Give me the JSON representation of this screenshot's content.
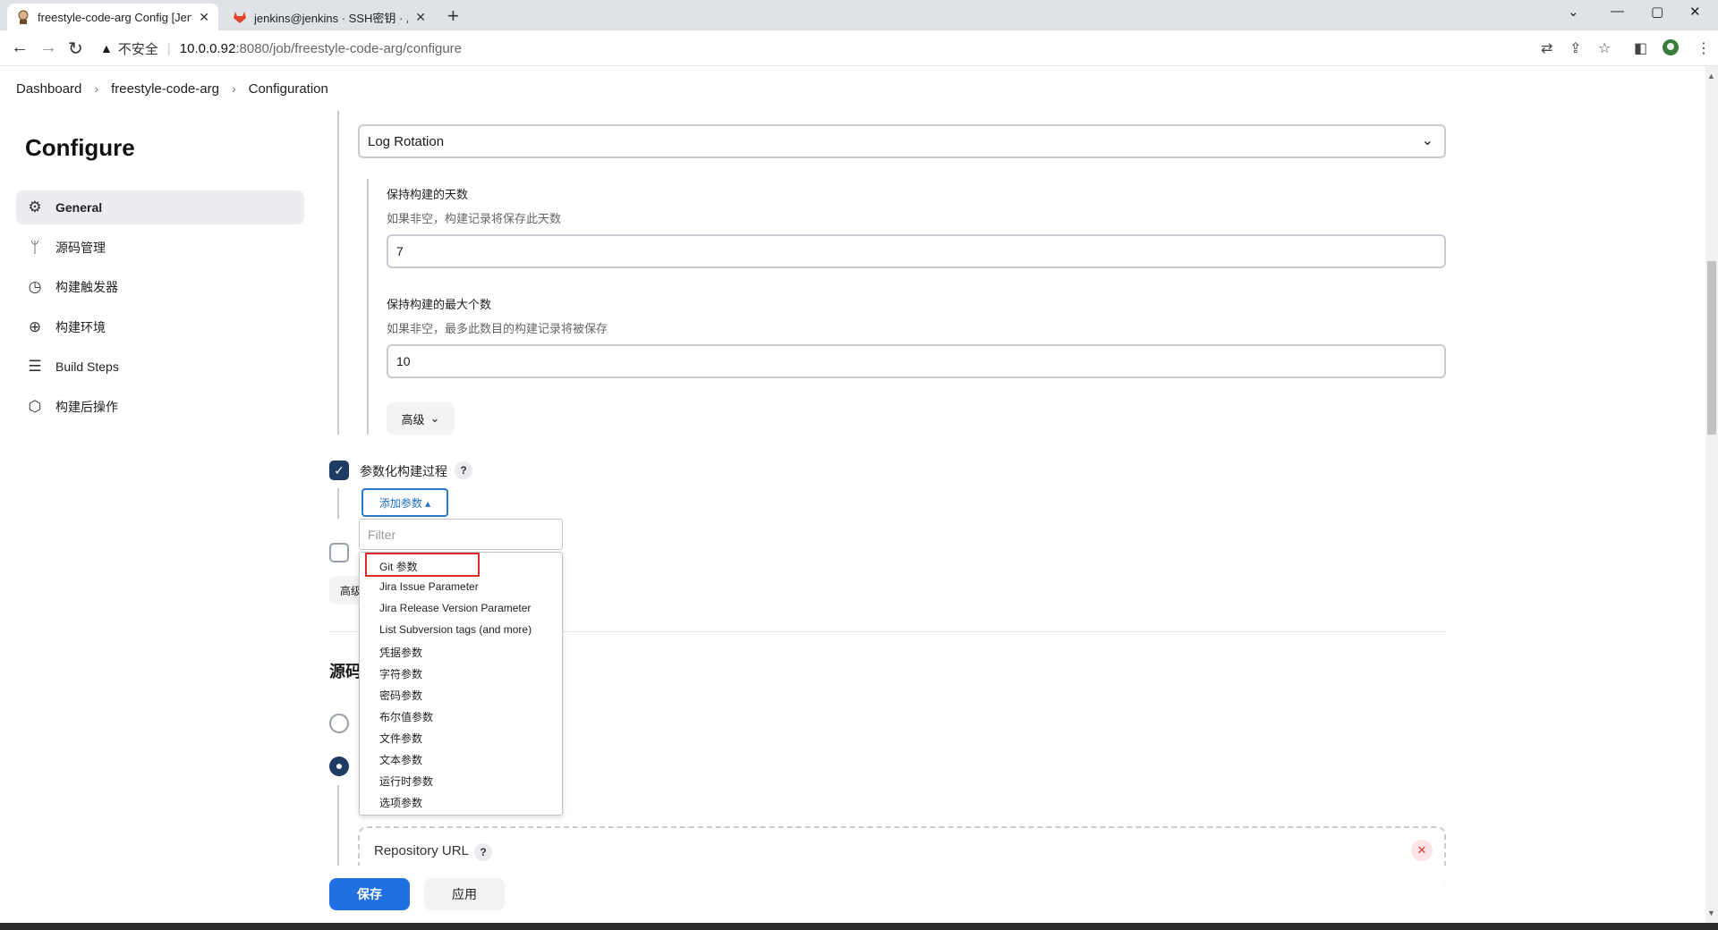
{
  "browser": {
    "tabs": [
      {
        "title": "freestyle-code-arg Config [Jenkins]",
        "active": true
      },
      {
        "title": "jenkins@jenkins · SSH密钥 · 用户设置 · GitLab",
        "active": false
      }
    ],
    "address": {
      "security_text": "不安全",
      "host": "10.0.0.92",
      "path": ":8080/job/freestyle-code-arg/configure"
    }
  },
  "breadcrumb": [
    "Dashboard",
    "freestyle-code-arg",
    "Configuration"
  ],
  "sidebar": {
    "title": "Configure",
    "items": [
      {
        "label": "General",
        "icon": "gear-icon",
        "active": true
      },
      {
        "label": "源码管理",
        "icon": "branch-icon"
      },
      {
        "label": "构建触发器",
        "icon": "clock-icon"
      },
      {
        "label": "构建环境",
        "icon": "globe-icon"
      },
      {
        "label": "Build Steps",
        "icon": "list-icon"
      },
      {
        "label": "构建后操作",
        "icon": "cube-icon"
      }
    ]
  },
  "form": {
    "strategy_value": "Log Rotation",
    "days_label": "保持构建的天数",
    "days_desc": "如果非空，构建记录将保存此天数",
    "days_value": "7",
    "max_label": "保持构建的最大个数",
    "max_desc": "如果非空，最多此数目的构建记录将被保存",
    "max_value": "10",
    "advanced_label": "高级",
    "parameterized_label": "参数化构建过程",
    "parameterized_checked": true,
    "help_label": "?",
    "add_param_label": "添加参数 ▴",
    "filter_placeholder": "Filter",
    "param_menu": [
      "Git 参数",
      "Jira Issue Parameter",
      "Jira Release Version Parameter",
      "List Subversion tags (and more)",
      "凭据参数",
      "字符参数",
      "密码参数",
      "布尔值参数",
      "文件参数",
      "文本参数",
      "运行时参数",
      "选项参数"
    ],
    "partial_advanced": "高级",
    "section_scm_partial": "源码",
    "repo_url_label": "Repository URL"
  },
  "footer": {
    "save_label": "保存",
    "apply_label": "应用"
  },
  "colors": {
    "primary": "#1f6fe0",
    "checkbox": "#1d3b63",
    "highlight": "#e02a2a"
  }
}
